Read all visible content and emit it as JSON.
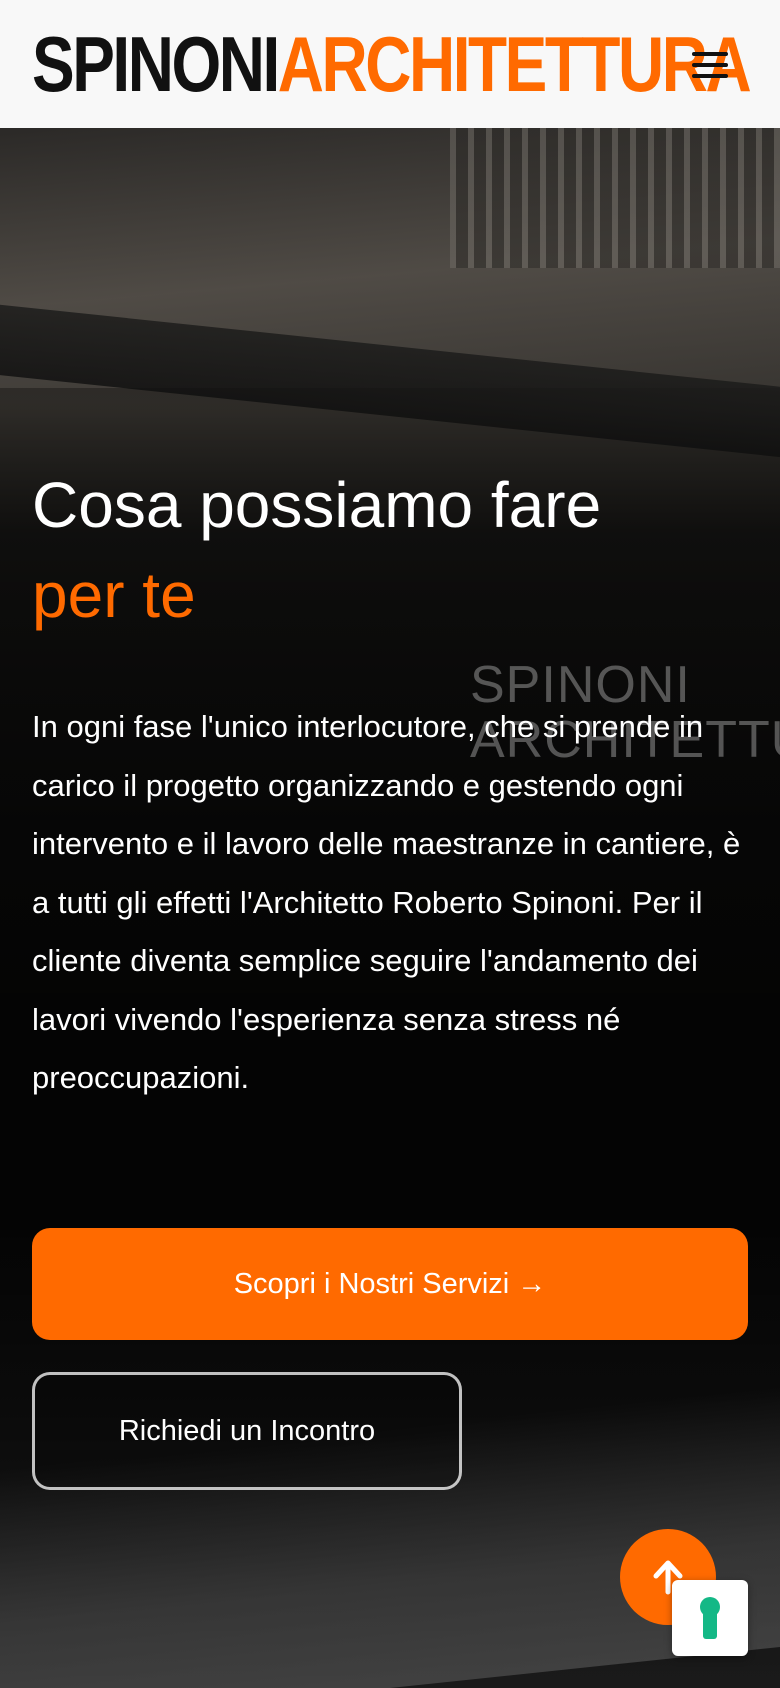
{
  "header": {
    "logo_part1": "SPINONI",
    "logo_part2": "ARCHITETTURA",
    "menu_icon": "hamburger-menu-icon"
  },
  "hero": {
    "title_line1": "Cosa possiamo fare",
    "title_line2": "per te",
    "description": "In ogni fase l'unico interlocutore, che si prende in carico il progetto organizzando e gestendo ogni intervento e il lavoro delle maestranze in cantiere, è a tutti gli effetti l'Architetto Roberto Spinoni. Per il cliente diventa semplice seguire l'andamento dei lavori vivendo l'esperienza senza stress né preoccupazioni.",
    "background_sign_line1": "SPINONI",
    "background_sign_line2": "ARCHITETTUR",
    "primary_button": "Scopri i Nostri Servizi →",
    "secondary_button": "Richiedi un Incontro"
  },
  "floating": {
    "scroll_top_icon": "arrow-up-icon",
    "widget_icon": "keyhole-icon"
  },
  "colors": {
    "accent": "#ff6a00",
    "header_bg": "#f8f8f8",
    "logo_dark": "#111111",
    "widget_green": "#14b886"
  }
}
